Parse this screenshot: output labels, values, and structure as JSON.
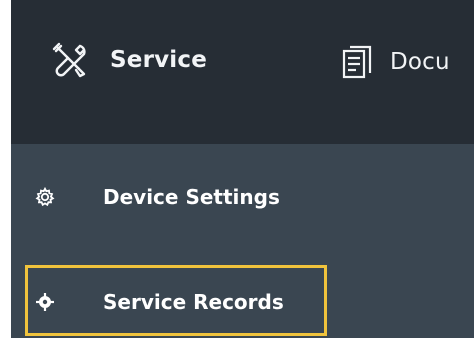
{
  "topnav": {
    "service": {
      "label": "Service",
      "icon": "tools-icon"
    },
    "documents": {
      "label": "Docu",
      "icon": "document-icon"
    }
  },
  "sidebar": {
    "items": [
      {
        "label": "Device Settings",
        "icon": "gear-icon"
      },
      {
        "label": "Service Records",
        "icon": "target-icon",
        "highlighted": true
      }
    ]
  },
  "colors": {
    "topbar": "#262d35",
    "sidebar": "#3a4651",
    "highlight": "#f0c33c",
    "text": "#ffffff"
  }
}
